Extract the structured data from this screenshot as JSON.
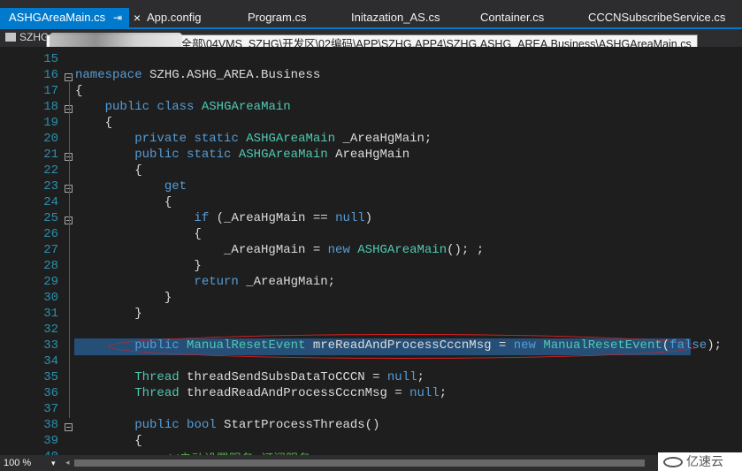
{
  "tabs": [
    {
      "label": "ASHGAreaMain.cs",
      "active": true
    },
    {
      "label": "App.config"
    },
    {
      "label": "Program.cs"
    },
    {
      "label": "Initazation_AS.cs"
    },
    {
      "label": "Container.cs"
    },
    {
      "label": "CCCNSubscribeService.cs"
    }
  ],
  "tab_pin_glyph": "⇥",
  "tab_close_glyph": "×",
  "nav": {
    "project_prefix": "SZHG"
  },
  "tooltip": {
    "path_tail": "\\全部\\04VMS_SZHG\\开发区\\02编码\\APP\\SZHG.APP4\\SZHG.ASHG_AREA.Business\\ASHGAreaMain.cs"
  },
  "code_lines": [
    {
      "num": "15",
      "text": ""
    },
    {
      "num": "16",
      "text": "namespace SZHG.ASHG_AREA.Business"
    },
    {
      "num": "17",
      "text": "{"
    },
    {
      "num": "18",
      "text": "    public class ASHGAreaMain"
    },
    {
      "num": "19",
      "text": "    {"
    },
    {
      "num": "20",
      "text": "        private static ASHGAreaMain _AreaHgMain;"
    },
    {
      "num": "21",
      "text": "        public static ASHGAreaMain AreaHgMain"
    },
    {
      "num": "22",
      "text": "        {"
    },
    {
      "num": "23",
      "text": "            get"
    },
    {
      "num": "24",
      "text": "            {"
    },
    {
      "num": "25",
      "text": "                if (_AreaHgMain == null)"
    },
    {
      "num": "26",
      "text": "                {"
    },
    {
      "num": "27",
      "text": "                    _AreaHgMain = new ASHGAreaMain(); ;"
    },
    {
      "num": "28",
      "text": "                }"
    },
    {
      "num": "29",
      "text": "                return _AreaHgMain;"
    },
    {
      "num": "30",
      "text": "            }"
    },
    {
      "num": "31",
      "text": "        }"
    },
    {
      "num": "32",
      "text": ""
    },
    {
      "num": "33",
      "text": "        public ManualResetEvent mreReadAndProcessCccnMsg = new ManualResetEvent(false);"
    },
    {
      "num": "34",
      "text": ""
    },
    {
      "num": "35",
      "text": "        Thread threadSendSubsDataToCCCN = null;"
    },
    {
      "num": "36",
      "text": "        Thread threadReadAndProcessCccnMsg = null;"
    },
    {
      "num": "37",
      "text": ""
    },
    {
      "num": "38",
      "text": "        public bool StartProcessThreads()"
    },
    {
      "num": "39",
      "text": "        {"
    },
    {
      "num": "40",
      "text": "            //自动设置服务 订阅服务"
    }
  ],
  "status": {
    "zoom": "100 %",
    "zoom_arrow": "▾",
    "scroll_left": "◂"
  },
  "watermark": {
    "text": "亿速云"
  },
  "colors": {
    "accent": "#007acc",
    "keyword": "#569cd6",
    "type": "#4ec9b0",
    "selection": "#264f78",
    "annotation": "#e02020"
  }
}
